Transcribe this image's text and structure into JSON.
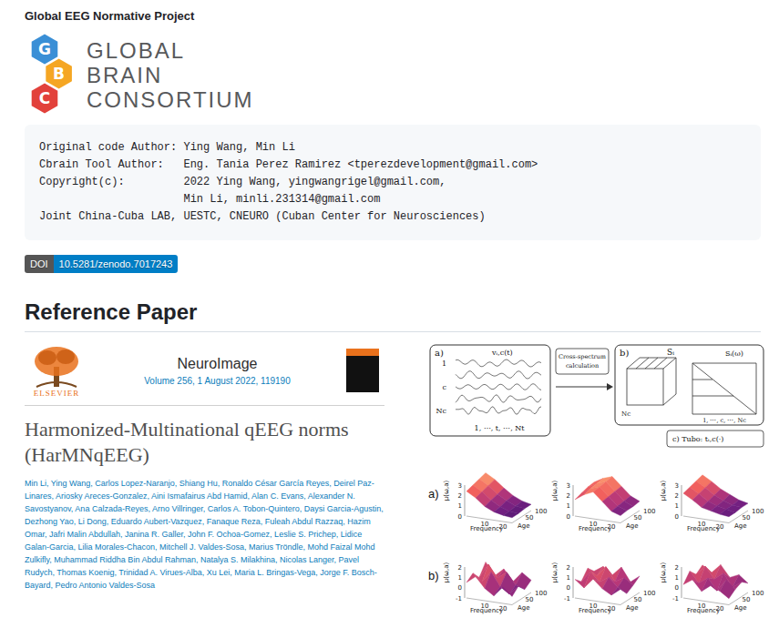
{
  "page": {
    "title": "Global EEG Normative Project"
  },
  "logo": {
    "letters": [
      {
        "text": "G",
        "color": "#3a8fd6"
      },
      {
        "text": "B",
        "color": "#f5a623"
      },
      {
        "text": "C",
        "color": "#e2413b"
      }
    ],
    "lines": [
      "GLOBAL",
      "BRAIN",
      "CONSORTIUM"
    ]
  },
  "code_block": {
    "lines": [
      "Original code Author: Ying Wang, Min Li",
      "Cbrain Tool Author:   Eng. Tania Perez Ramirez <tperezdevelopment@gmail.com>",
      "Copyright(c):         2022 Ying Wang, yingwangrigel@gmail.com,",
      "                      Min Li, minli.231314@gmail.com",
      "Joint China-Cuba LAB, UESTC, CNEURO (Cuban Center for Neurosciences)"
    ]
  },
  "doi_badge": {
    "label": "DOI",
    "value": "10.5281/zenodo.7017243"
  },
  "section": {
    "heading": "Reference Paper"
  },
  "paper": {
    "publisher": "ELSEVIER",
    "journal": "NeuroImage",
    "volume": "Volume 256, 1 August 2022, 119190",
    "title": "Harmonized-Multinational qEEG norms (HarMNqEEG)",
    "authors": "Min Li, Ying Wang, Carlos Lopez-Naranjo, Shiang Hu, Ronaldo César García Reyes, Deirel Paz-Linares, Ariosky Areces-Gonzalez, Aini Ismafairus Abd Hamid, Alan C. Evans, Alexander N. Savostyanov, Ana Calzada-Reyes, Arno Villringer, Carlos A. Tobon-Quintero, Daysi Garcia-Agustin, Dezhong Yao, Li Dong, Eduardo Aubert-Vazquez, Fanaque Reza, Fuleah Abdul Razzaq, Hazim Omar, Jafri Malin Abdullah, Janina R. Galler, John F. Ochoa-Gomez, Leslie S. Prichep, Lidice Galan-Garcia, Lilia Morales-Chacon, Mitchell J. Valdes-Sosa, Marius Tröndle, Mohd Faizal Mohd Zulkifly, Muhammad Riddha Bin Abdul Rahman, Natalya S. Milakhina, Nicolas Langer, Pavel Rudych, Thomas Koenig, Trinidad A. Virues-Alba, Xu Lei, Maria L. Bringas-Vega, Jorge F. Bosch-Bayard, Pedro Antonio Valdes-Sosa"
  },
  "figure": {
    "diagram": {
      "box_a": {
        "label": "a)",
        "signal": "vᵢ,c(t)",
        "channels": [
          "1",
          "c",
          "Nc"
        ],
        "time": "1, ⋯, t, ⋯, Nt"
      },
      "arrow": [
        "Cross-spectrum",
        "calculation"
      ],
      "box_b": {
        "label": "b)",
        "cube": "Sᵢ",
        "matrix": "Sᵢ(ω)",
        "nc": "Nc",
        "axis": "1, ⋯, c, ⋯, Nc"
      },
      "box_c": "c) Tubo: tᵢ,c(·)"
    },
    "rows": [
      {
        "label": "a)",
        "plots": [
          {
            "zlabel": "μ(ω,a)",
            "zticks": [
              "3",
              "2",
              "1",
              "0"
            ],
            "x_title": "Frequency",
            "x_ticks": [
              "10",
              "20"
            ],
            "y_title": "Age",
            "y_ticks": [
              "50",
              "100"
            ],
            "surface": [
              [
                2.4,
                1.9,
                1.2,
                0.8,
                0.6,
                0.5
              ],
              [
                2.6,
                2.1,
                1.4,
                0.9,
                0.6,
                0.5
              ],
              [
                2.8,
                2.3,
                1.6,
                1.1,
                0.7,
                0.6
              ],
              [
                3.0,
                2.5,
                1.8,
                1.2,
                0.8,
                0.6
              ]
            ]
          },
          {
            "zlabel": "μ(ω,a)",
            "zticks": [
              "3",
              "2",
              "1",
              "0"
            ],
            "x_title": "Frequency",
            "x_ticks": [
              "10",
              "20"
            ],
            "y_title": "Age",
            "y_ticks": [
              "50",
              "100"
            ],
            "surface": [
              [
                1.6,
                2.2,
                2.6,
                1.8,
                1.0,
                0.7
              ],
              [
                1.8,
                2.4,
                2.7,
                1.9,
                1.1,
                0.8
              ],
              [
                2.0,
                2.5,
                2.8,
                2.0,
                1.2,
                0.8
              ],
              [
                2.1,
                2.6,
                2.9,
                2.1,
                1.3,
                0.9
              ]
            ]
          },
          {
            "zlabel": "μ(ω,a)",
            "zticks": [
              "3",
              "2",
              "1",
              "0"
            ],
            "x_title": "Frequency",
            "x_ticks": [
              "10",
              "20"
            ],
            "y_title": "Age",
            "y_ticks": [
              "50",
              "100"
            ],
            "surface": [
              [
                2.2,
                1.7,
                1.1,
                0.9,
                0.7,
                0.6
              ],
              [
                2.4,
                1.9,
                1.3,
                1.0,
                0.8,
                0.6
              ],
              [
                2.6,
                2.1,
                1.5,
                1.1,
                0.8,
                0.7
              ],
              [
                2.8,
                2.3,
                1.7,
                1.3,
                0.9,
                0.7
              ]
            ]
          }
        ]
      },
      {
        "label": "b)",
        "plots": [
          {
            "zlabel": "μ(ω,a)",
            "zticks": [
              "2",
              "1",
              "0",
              "-1"
            ],
            "x_title": "Frequency",
            "x_ticks": [
              "10",
              "20"
            ],
            "y_title": "Age",
            "y_ticks": [
              "50",
              "100"
            ],
            "surface": [
              [
                0.5,
                1.2,
                0.2,
                -0.4,
                0.6,
                -0.2
              ],
              [
                1.0,
                0.3,
                1.4,
                0.1,
                -0.5,
                0.4
              ],
              [
                0.2,
                1.6,
                0.4,
                1.1,
                0.0,
                -0.3
              ],
              [
                1.3,
                0.1,
                0.9,
                -0.2,
                0.8,
                0.2
              ]
            ]
          },
          {
            "zlabel": "μ(ω,a)",
            "zticks": [
              "2",
              "1",
              "0",
              "-1"
            ],
            "x_title": "Frequency",
            "x_ticks": [
              "10",
              "20"
            ],
            "y_title": "Age",
            "y_ticks": [
              "50",
              "100"
            ],
            "surface": [
              [
                0.8,
                0.1,
                1.1,
                0.3,
                -0.2,
                0.5
              ],
              [
                0.2,
                1.3,
                0.4,
                1.0,
                0.2,
                -0.3
              ],
              [
                1.1,
                0.5,
                1.5,
                0.2,
                0.7,
                0.1
              ],
              [
                0.4,
                1.0,
                0.3,
                1.2,
                -0.1,
                0.6
              ]
            ]
          },
          {
            "zlabel": "μ(ω,a)",
            "zticks": [
              "2",
              "1",
              "0",
              "-1"
            ],
            "x_title": "Frequency",
            "x_ticks": [
              "10",
              "20"
            ],
            "y_title": "Age",
            "y_ticks": [
              "50",
              "100"
            ],
            "surface": [
              [
                0.3,
                0.9,
                -0.1,
                0.6,
                0.2,
                -0.4
              ],
              [
                1.2,
                0.2,
                0.8,
                -0.3,
                0.9,
                0.1
              ],
              [
                0.5,
                1.4,
                0.3,
                1.0,
                -0.2,
                0.4
              ],
              [
                1.0,
                0.4,
                1.3,
                0.2,
                0.6,
                -0.1
              ]
            ]
          }
        ]
      }
    ]
  }
}
